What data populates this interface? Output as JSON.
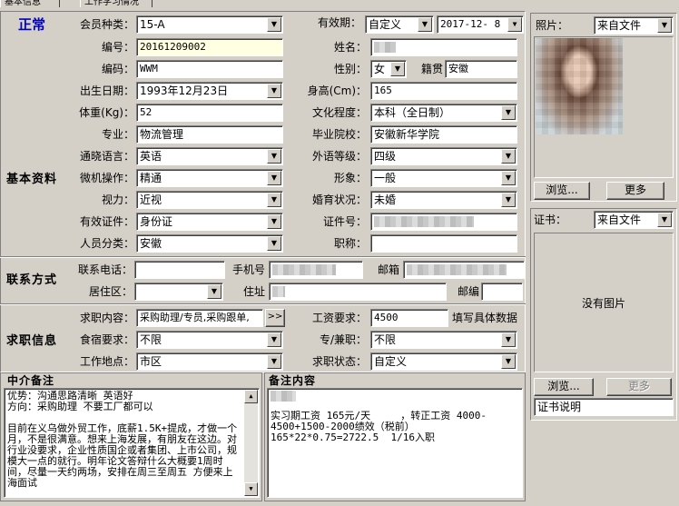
{
  "tabs": [
    "基本信息",
    "工作学习情况"
  ],
  "status": "正常",
  "sections": {
    "basic": "基本资料",
    "contact": "联系方式",
    "job": "求职信息"
  },
  "labels": {
    "member_type": "会员种类：",
    "valid_period": "有效期：",
    "number": "编号：",
    "name": "姓名：",
    "code": "编码：",
    "gender": "性别：",
    "native": "籍贯",
    "birth": "出生日期：",
    "height": "身高(Cm)：",
    "weight": "体重(Kg)：",
    "education": "文化程度：",
    "major": "专业：",
    "school": "毕业院校：",
    "language": "通晓语言：",
    "foreign_level": "外语等级：",
    "computer": "微机操作：",
    "appearance": "形象：",
    "vision": "视力：",
    "marital": "婚育状况：",
    "id_type": "有效证件：",
    "id_number": "证件号：",
    "person_type": "人员分类：",
    "title": "职称：",
    "phone": "联系电话：",
    "mobile": "手机号",
    "email": "邮箱",
    "district": "居住区：",
    "address": "住址",
    "postcode": "邮编",
    "job_content": "求职内容：",
    "salary": "工资要求：",
    "salary_hint": "填写具体数据",
    "housing": "食宿要求：",
    "fulltime": "专/兼职：",
    "workplace": "工作地点：",
    "job_status": "求职状态：",
    "photo": "照片：",
    "cert": "证书：",
    "agent_notes": "中介备注",
    "remarks": "备注内容"
  },
  "values": {
    "member_type": "15-A",
    "valid_period": "自定义",
    "valid_date": "2017-12- 8",
    "number": "20161209002",
    "code": "WWM",
    "gender": "女",
    "native": "安徽",
    "birth": "1993年12月23日",
    "height": "165",
    "weight": "52",
    "education": "本科（全日制）",
    "major": "物流管理",
    "school": "安徽新华学院",
    "language": "英语",
    "foreign_level": "四级",
    "computer": "精通",
    "appearance": "一般",
    "vision": "近视",
    "marital": "未婚",
    "id_type": "身份证",
    "person_type": "安徽",
    "phone": "",
    "district": "",
    "postcode": "",
    "job_content": "采购助理/专员,采购跟单,",
    "salary": "4500",
    "housing": "不限",
    "fulltime": "不限",
    "workplace": "市区",
    "job_status": "自定义",
    "photo_source": "来自文件",
    "cert_source": "来自文件"
  },
  "buttons": {
    "job_more": ">>",
    "photo_browse": "浏览...",
    "photo_more": "更多",
    "cert_browse": "浏览...",
    "cert_more": "更多"
  },
  "cert": {
    "no_image": "没有图片",
    "desc": "证书说明"
  },
  "notes": {
    "agent": "优势：沟通思路清晰 英语好\n方向：采购助理 不要工厂都可以\n\n目前在义乌做外贸工作，底薪1.5K+提成，才做一个月，不是很满意。想来上海发展，有朋友在这边。对行业没要求，企业性质国企或者集团、上市公司，规模大一点的就行。明年论文答辩什么大概要1周时间，尽量一天约两场，安排在周三至周五 方便来上海面试",
    "remarks": "实习期工资 165元/天     ，转正工资 4000-4500+1500-2000绩效（税前）\n165*22*0.75=2722.5  1/16入职"
  },
  "colors": {
    "status": "#0000c0",
    "bg": "#d4d0c8",
    "input_highlight": "#ffffe1"
  }
}
